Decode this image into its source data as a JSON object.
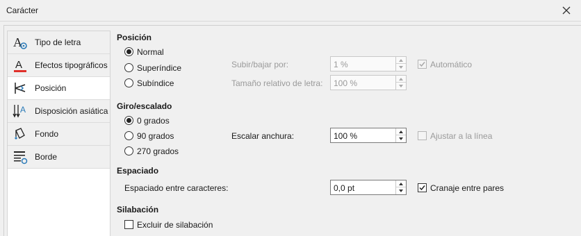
{
  "window": {
    "title": "Carácter"
  },
  "sidebar": {
    "items": [
      {
        "label": "Tipo de letra",
        "icon": "font-settings-icon"
      },
      {
        "label": "Efectos tipográficos",
        "icon": "font-color-icon"
      },
      {
        "label": "Posición",
        "icon": "position-icon"
      },
      {
        "label": "Disposición asiática",
        "icon": "asian-layout-icon"
      },
      {
        "label": "Fondo",
        "icon": "background-fill-icon"
      },
      {
        "label": "Borde",
        "icon": "border-icon"
      }
    ],
    "selected": "Posición"
  },
  "position": {
    "heading": "Posición",
    "options": [
      "Normal",
      "Superíndice",
      "Subíndice"
    ],
    "selected": "Normal",
    "raise_label": "Subir/bajar por:",
    "raise_value": "1 %",
    "rel_size_label": "Tamaño relativo de letra:",
    "rel_size_value": "100 %",
    "auto_label": "Automático",
    "auto_checked": true
  },
  "rotation": {
    "heading": "Giro/escalado",
    "options": [
      "0 grados",
      "90 grados",
      "270 grados"
    ],
    "selected": "0 grados",
    "scale_label": "Escalar anchura:",
    "scale_value": "100 %",
    "fit_label": "Ajustar a la línea",
    "fit_checked": false
  },
  "spacing": {
    "heading": "Espaciado",
    "char_label": "Espaciado entre caracteres:",
    "char_value": "0,0 pt",
    "kerning_label": "Cranaje entre pares",
    "kerning_checked": true
  },
  "hyphenation": {
    "heading": "Silabación",
    "exclude_label": "Excluir de silabación",
    "exclude_checked": false
  },
  "colors": {
    "accent_red": "#e0302a",
    "icon_blue": "#2a7ab8"
  }
}
